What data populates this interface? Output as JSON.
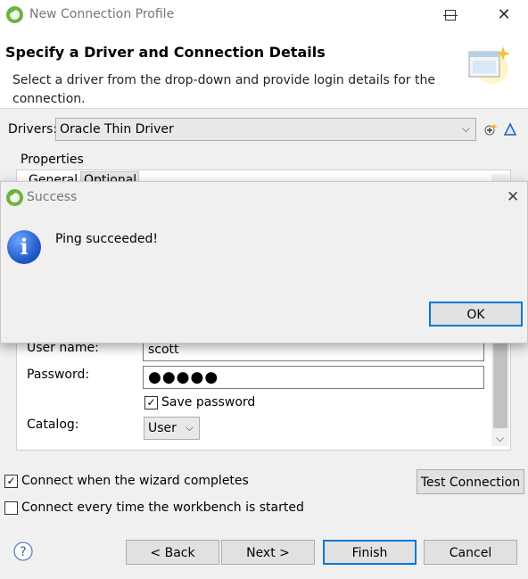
{
  "window": {
    "title": "New Connection Profile"
  },
  "header": {
    "title": "Specify a Driver and Connection Details",
    "description": "Select a driver from the drop-down and provide login details for the connection."
  },
  "drivers": {
    "label": "Drivers:",
    "selected": "Oracle Thin Driver"
  },
  "properties": {
    "label": "Properties",
    "tab_general": "General",
    "tab_optional": "Optional"
  },
  "form": {
    "username_label": "User name:",
    "username_value": "scott",
    "password_label": "Password:",
    "password_value": "●●●●●",
    "save_password_label": "Save password",
    "catalog_label": "Catalog:",
    "catalog_value": "User"
  },
  "options": {
    "connect_on_complete": "Connect when the wizard completes",
    "connect_every_time": "Connect every time the workbench is started",
    "test_connection": "Test Connection"
  },
  "buttons": {
    "back": "< Back",
    "next": "Next >",
    "finish": "Finish",
    "cancel": "Cancel"
  },
  "dialog": {
    "title": "Success",
    "message": "Ping succeeded!",
    "ok": "OK"
  }
}
